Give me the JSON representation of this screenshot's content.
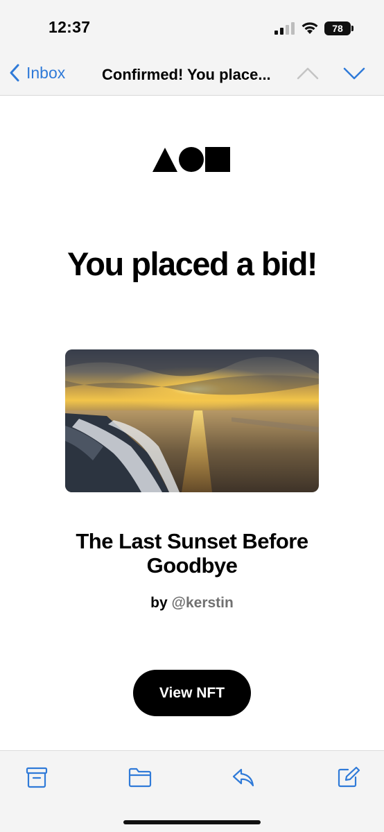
{
  "status_bar": {
    "time": "12:37",
    "battery": "78"
  },
  "nav": {
    "back_label": "Inbox",
    "title": "Confirmed! You place...",
    "accent_color": "#2f7ad8"
  },
  "email": {
    "headline": "You placed a bid!",
    "nft_title": "The Last Sunset Before Goodbye",
    "by_label": "by",
    "handle": "@kerstin",
    "button_label": "View NFT"
  },
  "icons": {
    "signal": "cellular-signal-icon",
    "wifi": "wifi-icon",
    "battery": "battery-icon",
    "back": "chevron-left-icon",
    "prev": "chevron-up-icon",
    "next": "chevron-down-icon",
    "logo": "triangle-circle-square-logo",
    "archive": "archive-icon",
    "folder": "folder-icon",
    "reply": "reply-icon",
    "compose": "compose-icon"
  }
}
